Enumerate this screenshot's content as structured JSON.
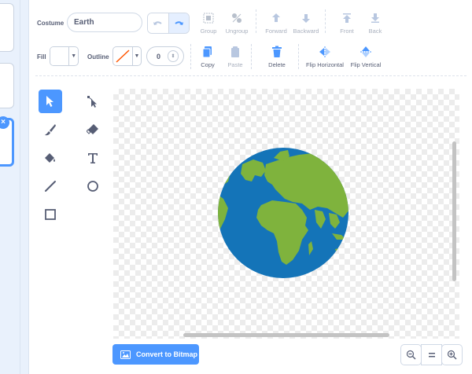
{
  "costume": {
    "label": "Costume",
    "name": "Earth"
  },
  "toolbar": {
    "group_label": "Group",
    "ungroup_label": "Ungroup",
    "forward_label": "Forward",
    "backward_label": "Backward",
    "front_label": "Front",
    "back_label": "Back",
    "copy_label": "Copy",
    "paste_label": "Paste",
    "delete_label": "Delete",
    "flip_h_label": "Flip Horizontal",
    "flip_v_label": "Flip Vertical"
  },
  "fill": {
    "label": "Fill",
    "color": "#ffffff"
  },
  "outline": {
    "label": "Outline",
    "color": "none",
    "width": "0"
  },
  "tools": [
    "select",
    "reshape",
    "brush",
    "eraser",
    "fill",
    "text",
    "line",
    "circle",
    "rectangle"
  ],
  "convert_label": "Convert to Bitmap",
  "colors": {
    "accent": "#4c97ff",
    "ocean": "#1474b8",
    "land": "#7fb33d"
  }
}
